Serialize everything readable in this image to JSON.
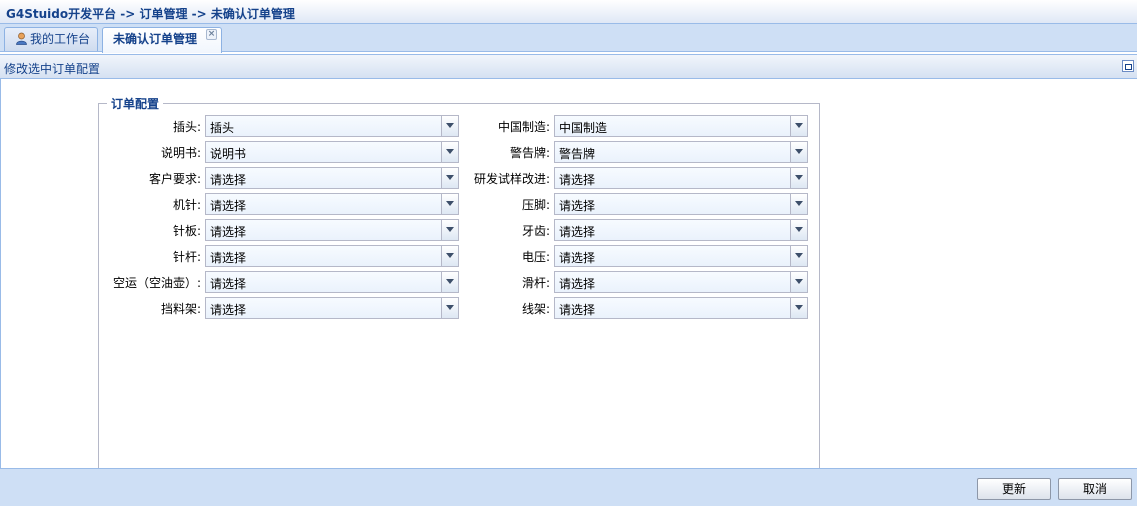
{
  "breadcrumb": "G4Stuido开发平台 -> 订单管理 -> 未确认订单管理",
  "tabs": [
    {
      "label": "我的工作台",
      "icon": "user-icon"
    },
    {
      "label": "未确认订单管理",
      "close": "×"
    }
  ],
  "panel": {
    "title": "修改选中订单配置"
  },
  "fieldset": {
    "legend": "订单配置"
  },
  "left_fields": [
    {
      "label": "插头:",
      "value": "插头"
    },
    {
      "label": "说明书:",
      "value": "说明书"
    },
    {
      "label": "客户要求:",
      "value": "请选择"
    },
    {
      "label": "机针:",
      "value": "请选择"
    },
    {
      "label": "针板:",
      "value": "请选择"
    },
    {
      "label": "针杆:",
      "value": "请选择"
    },
    {
      "label": "空运（空油壶）:",
      "value": "请选择"
    },
    {
      "label": "挡料架:",
      "value": "请选择"
    }
  ],
  "right_fields": [
    {
      "label": "中国制造:",
      "value": "中国制造"
    },
    {
      "label": "警告牌:",
      "value": "警告牌"
    },
    {
      "label": "研发试样改进:",
      "value": "请选择"
    },
    {
      "label": "压脚:",
      "value": "请选择"
    },
    {
      "label": "牙齿:",
      "value": "请选择"
    },
    {
      "label": "电压:",
      "value": "请选择"
    },
    {
      "label": "滑杆:",
      "value": "请选择"
    },
    {
      "label": "线架:",
      "value": "请选择"
    }
  ],
  "buttons": {
    "update": "更新",
    "cancel": "取消"
  }
}
